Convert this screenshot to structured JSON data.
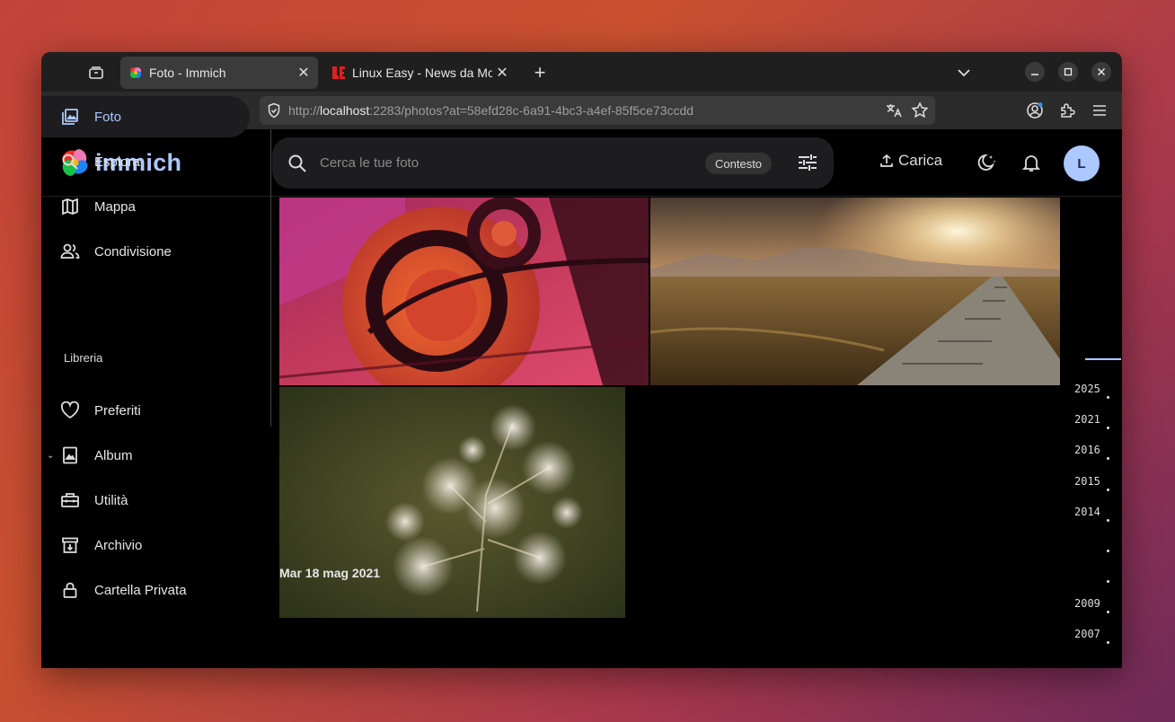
{
  "browser": {
    "tabs": [
      {
        "title": "Foto - Immich",
        "active": true
      },
      {
        "title": "Linux Easy - News da Mon",
        "active": false
      }
    ],
    "close_glyph": "✕",
    "new_tab_glyph": "+",
    "address": {
      "scheme": "http://",
      "host": "localhost",
      "rest": ":2283/photos?at=58efd28c-6a91-4bc3-a4ef-85f5ce73ccdd"
    }
  },
  "app": {
    "logo_text": "immich",
    "search": {
      "placeholder": "Cerca le tue foto",
      "context_label": "Contesto"
    },
    "upload_label": "Carica",
    "avatar_initial": "L",
    "accent": "#acc8ff"
  },
  "sidebar": {
    "items": [
      {
        "label": "Foto",
        "icon": "photos-icon",
        "active": true
      },
      {
        "label": "Esplora",
        "icon": "search-icon"
      },
      {
        "label": "Mappa",
        "icon": "map-icon"
      },
      {
        "label": "Condivisione",
        "icon": "people-icon"
      }
    ],
    "library_label": "Libreria",
    "library_items": [
      {
        "label": "Preferiti",
        "icon": "heart-icon"
      },
      {
        "label": "Album",
        "icon": "album-icon",
        "expander": "⌄"
      },
      {
        "label": "Utilità",
        "icon": "toolbox-icon"
      },
      {
        "label": "Archivio",
        "icon": "archive-icon"
      },
      {
        "label": "Cartella Privata",
        "icon": "lock-icon"
      }
    ]
  },
  "timeline": {
    "date_group_label": "Mar 18 mag 2021",
    "years": [
      "2025",
      "2021",
      "2016",
      "2015",
      "2014",
      "2009",
      "2007"
    ]
  }
}
